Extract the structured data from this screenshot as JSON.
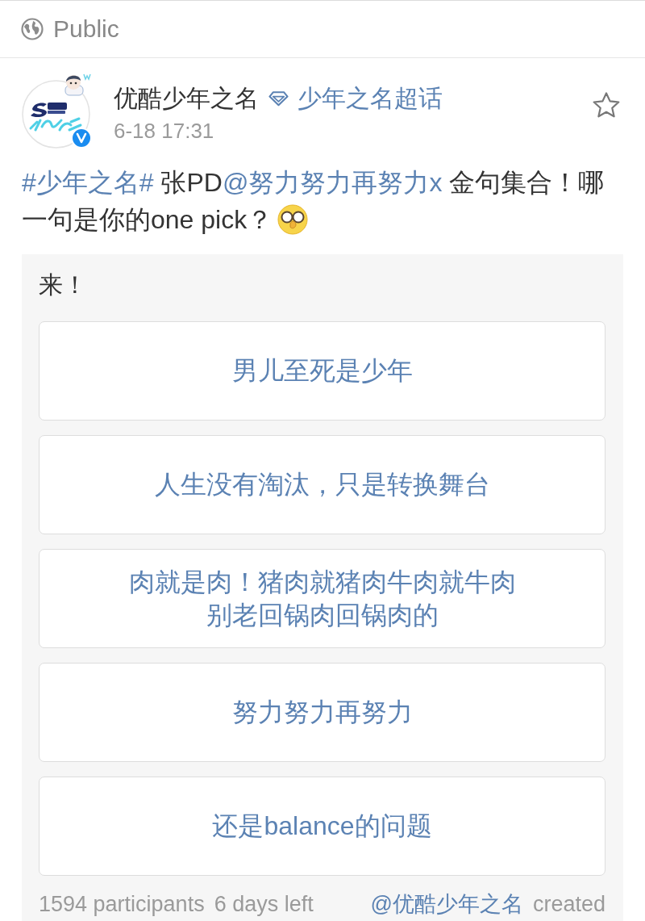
{
  "header": {
    "visibility": "Public"
  },
  "post": {
    "author": "优酷少年之名",
    "verified": true,
    "supertopic": "少年之名超话",
    "time": "6-18 17:31",
    "text": [
      {
        "kind": "topic",
        "text": "#少年之名#"
      },
      {
        "kind": "plain",
        "text": " 张PD"
      },
      {
        "kind": "mention",
        "text": "@努力努力再努力x"
      },
      {
        "kind": "plain",
        "text": " 金句集合！哪一句是你的one pick？"
      },
      {
        "kind": "emoji"
      }
    ]
  },
  "poll": {
    "title": "来！",
    "options": [
      {
        "lines": [
          "男儿至死是少年"
        ]
      },
      {
        "lines": [
          "人生没有淘汰，只是转换舞台"
        ]
      },
      {
        "lines": [
          "肉就是肉！猪肉就猪肉牛肉就牛肉",
          "别老回锅肉回锅肉的"
        ]
      },
      {
        "lines": [
          "努力努力再努力"
        ]
      },
      {
        "lines": [
          "还是balance的问题"
        ]
      }
    ],
    "participants": "1594 participants",
    "time_left": "6 days left",
    "creator": "@优酷少年之名",
    "created": "created"
  }
}
